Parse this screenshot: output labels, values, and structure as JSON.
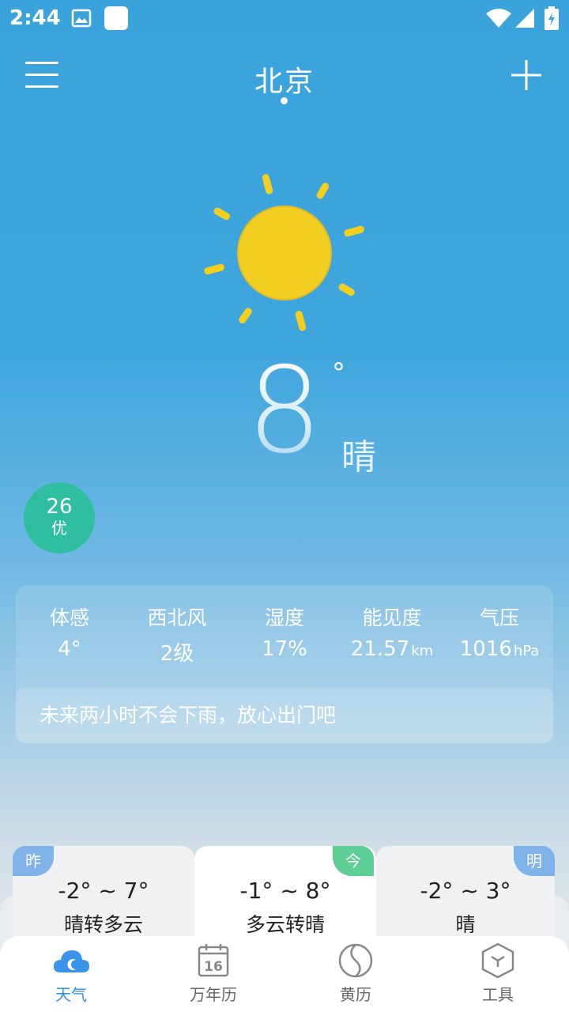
{
  "status_bar": {
    "time": "2:44"
  },
  "header": {
    "city": "北京"
  },
  "current": {
    "temperature": "8",
    "degree_symbol": "°",
    "condition": "晴"
  },
  "aqi": {
    "value": "26",
    "level": "优",
    "color": "#2fbfa0"
  },
  "details": [
    {
      "label": "体感",
      "value": "4°",
      "unit": ""
    },
    {
      "label": "西北风",
      "value": "2级",
      "unit": ""
    },
    {
      "label": "湿度",
      "value": "17%",
      "unit": ""
    },
    {
      "label": "能见度",
      "value": "21.57",
      "unit": "km"
    },
    {
      "label": "气压",
      "value": "1016",
      "unit": "hPa"
    }
  ],
  "rain_tip": "未来两小时不会下雨，放心出门吧",
  "forecast": {
    "yesterday": {
      "tag": "昨",
      "range": "-2° ~ 7°",
      "desc": "晴转多云"
    },
    "today": {
      "tag": "今",
      "range": "-1° ~ 8°",
      "desc": "多云转晴"
    },
    "tomorrow": {
      "tag": "明",
      "range": "-2° ~ 3°",
      "desc": "晴"
    }
  },
  "bottom_nav": {
    "items": [
      {
        "label": "天气",
        "icon": "cloud-moon-icon"
      },
      {
        "label": "万年历",
        "icon": "calendar-icon",
        "icon_text": "16"
      },
      {
        "label": "黄历",
        "icon": "yinyang-icon"
      },
      {
        "label": "工具",
        "icon": "cube-icon"
      }
    ],
    "active_color": "#2f8ee8"
  }
}
